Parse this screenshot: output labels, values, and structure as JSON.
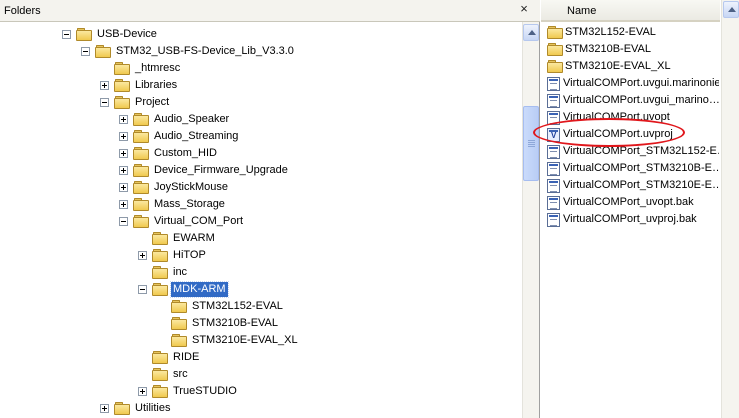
{
  "folders_pane": {
    "title": "Folders",
    "close_label": "×",
    "tree": [
      {
        "label": "USB-Device",
        "expander": "minus",
        "selected": false
      },
      {
        "label": "STM32_USB-FS-Device_Lib_V3.3.0",
        "expander": "minus",
        "selected": false
      },
      {
        "label": "_htmresc",
        "expander": "none",
        "selected": false
      },
      {
        "label": "Libraries",
        "expander": "plus",
        "selected": false
      },
      {
        "label": "Project",
        "expander": "minus",
        "selected": false
      },
      {
        "label": "Audio_Speaker",
        "expander": "plus",
        "selected": false
      },
      {
        "label": "Audio_Streaming",
        "expander": "plus",
        "selected": false
      },
      {
        "label": "Custom_HID",
        "expander": "plus",
        "selected": false
      },
      {
        "label": "Device_Firmware_Upgrade",
        "expander": "plus",
        "selected": false
      },
      {
        "label": "JoyStickMouse",
        "expander": "plus",
        "selected": false
      },
      {
        "label": "Mass_Storage",
        "expander": "plus",
        "selected": false
      },
      {
        "label": "Virtual_COM_Port",
        "expander": "minus",
        "selected": false
      },
      {
        "label": "EWARM",
        "expander": "none",
        "selected": false
      },
      {
        "label": "HiTOP",
        "expander": "plus",
        "selected": false
      },
      {
        "label": "inc",
        "expander": "none",
        "selected": false
      },
      {
        "label": "MDK-ARM",
        "expander": "minus",
        "selected": true
      },
      {
        "label": "STM32L152-EVAL",
        "expander": "none",
        "selected": false
      },
      {
        "label": "STM3210B-EVAL",
        "expander": "none",
        "selected": false
      },
      {
        "label": "STM3210E-EVAL_XL",
        "expander": "none",
        "selected": false
      },
      {
        "label": "RIDE",
        "expander": "none",
        "selected": false
      },
      {
        "label": "src",
        "expander": "none",
        "selected": false
      },
      {
        "label": "TrueSTUDIO",
        "expander": "plus",
        "selected": false
      },
      {
        "label": "Utilities",
        "expander": "plus",
        "selected": false
      }
    ]
  },
  "files_pane": {
    "column_header": "Name",
    "items": [
      {
        "label": "STM32L152-EVAL",
        "icon": "folder-icon"
      },
      {
        "label": "STM3210B-EVAL",
        "icon": "folder-icon"
      },
      {
        "label": "STM3210E-EVAL_XL",
        "icon": "folder-icon"
      },
      {
        "label": "VirtualCOMPort.uvgui.marinonie",
        "icon": "file-icon"
      },
      {
        "label": "VirtualCOMPort.uvgui_marino…",
        "icon": "file-icon"
      },
      {
        "label": "VirtualCOMPort.uvopt",
        "icon": "file-icon"
      },
      {
        "label": "VirtualCOMPort.uvproj",
        "icon": "uvproj-icon"
      },
      {
        "label": "VirtualCOMPort_STM32L152-E…",
        "icon": "file-icon"
      },
      {
        "label": "VirtualCOMPort_STM3210B-E…",
        "icon": "file-icon"
      },
      {
        "label": "VirtualCOMPort_STM3210E-E…",
        "icon": "file-icon"
      },
      {
        "label": "VirtualCOMPort_uvopt.bak",
        "icon": "file-icon"
      },
      {
        "label": "VirtualCOMPort_uvproj.bak",
        "icon": "file-icon"
      }
    ],
    "highlighted_item": "VirtualCOMPort.uvproj",
    "highlight_color": "#e0161b"
  },
  "colors": {
    "selection": "#316ac5",
    "folder": "#f0c94f"
  }
}
